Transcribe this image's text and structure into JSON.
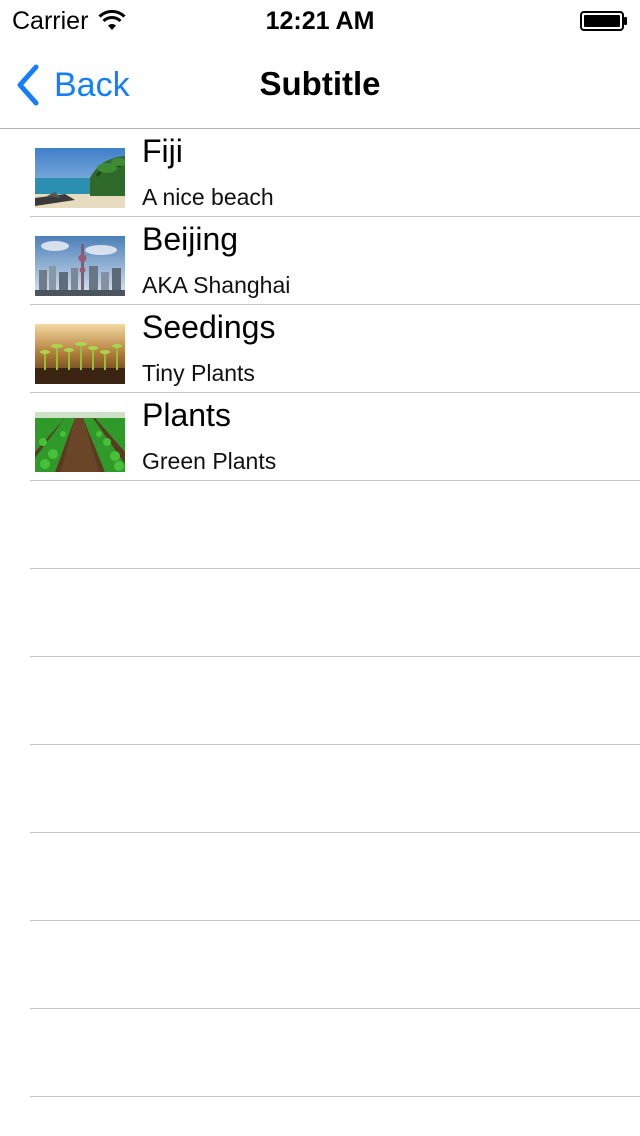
{
  "status_bar": {
    "carrier": "Carrier",
    "time": "12:21 AM"
  },
  "nav": {
    "back_label": "Back",
    "title": "Subtitle"
  },
  "accent_color": "#157efb",
  "rows": [
    {
      "title": "Fiji",
      "subtitle": "A nice beach",
      "image": "beach-photo"
    },
    {
      "title": "Beijing",
      "subtitle": "AKA Shanghai",
      "image": "city-skyline-photo"
    },
    {
      "title": "Seedings",
      "subtitle": "Tiny Plants",
      "image": "seedlings-photo"
    },
    {
      "title": "Plants",
      "subtitle": "Green Plants",
      "image": "crop-field-photo"
    }
  ]
}
